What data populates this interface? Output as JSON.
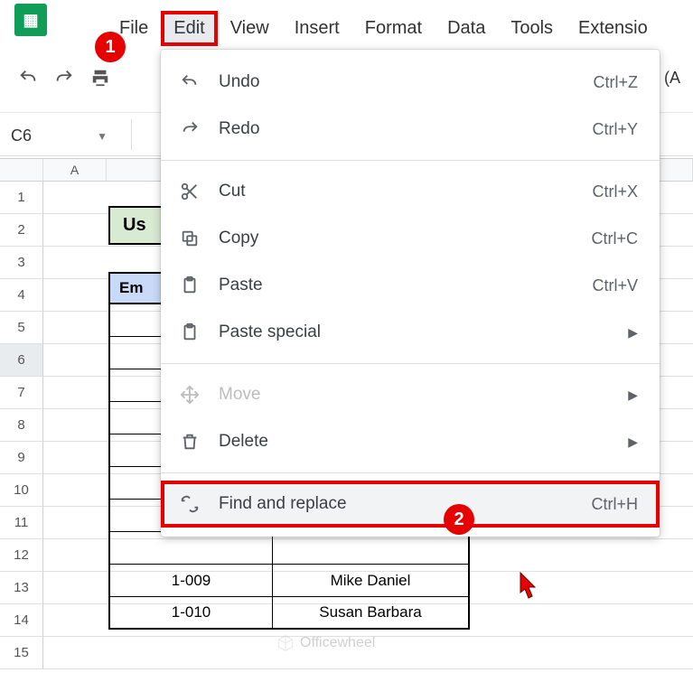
{
  "menubar": {
    "file": "File",
    "edit": "Edit",
    "view": "View",
    "insert": "Insert",
    "format": "Format",
    "data": "Data",
    "tools": "Tools",
    "extensions": "Extensio"
  },
  "toolbar": {
    "right_text": "ult (A"
  },
  "namebox": {
    "value": "C6"
  },
  "colheaders": {
    "a": "A"
  },
  "rownumbers": [
    "1",
    "2",
    "3",
    "4",
    "5",
    "6",
    "7",
    "8",
    "9",
    "10",
    "11",
    "12",
    "13",
    "14",
    "15"
  ],
  "usertable": {
    "title_fragment": "Us",
    "header_fragment": "Em",
    "rows": [
      {
        "id": "1-009",
        "name": "Mike Daniel"
      },
      {
        "id": "1-010",
        "name": "Susan Barbara"
      }
    ]
  },
  "dropdown": {
    "undo": {
      "label": "Undo",
      "shortcut": "Ctrl+Z"
    },
    "redo": {
      "label": "Redo",
      "shortcut": "Ctrl+Y"
    },
    "cut": {
      "label": "Cut",
      "shortcut": "Ctrl+X"
    },
    "copy": {
      "label": "Copy",
      "shortcut": "Ctrl+C"
    },
    "paste": {
      "label": "Paste",
      "shortcut": "Ctrl+V"
    },
    "paste_special": {
      "label": "Paste special"
    },
    "move": {
      "label": "Move"
    },
    "delete": {
      "label": "Delete"
    },
    "find_replace": {
      "label": "Find and replace",
      "shortcut": "Ctrl+H"
    }
  },
  "callouts": {
    "one": "1",
    "two": "2"
  },
  "watermark": "Officewheel"
}
